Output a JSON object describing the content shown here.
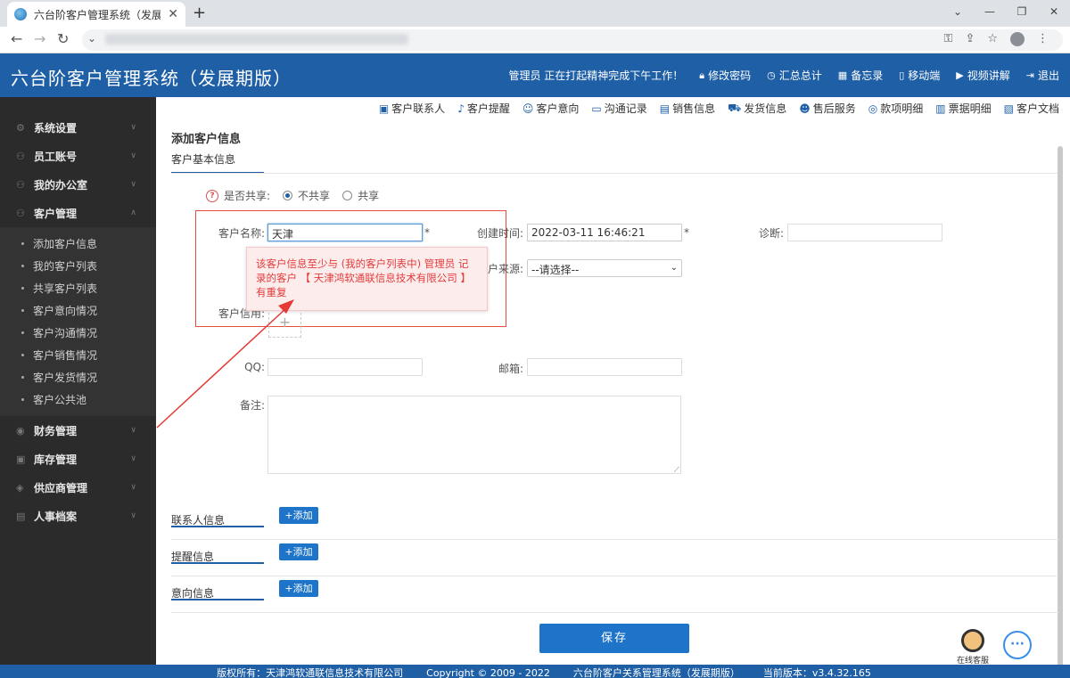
{
  "browser": {
    "tab_title": "六台阶客户管理系统（发展期版）",
    "close_tab": "✕",
    "new_tab": "+",
    "win_min": "⌄",
    "win_minimize": "—",
    "win_restore": "❐",
    "win_close": "✕"
  },
  "header": {
    "title": "六台阶客户管理系统（发展期版）",
    "welcome": "管理员 正在打起精神完成下午工作！",
    "links": [
      "修改密码",
      "汇总总计",
      "备忘录",
      "移动端",
      "视频讲解",
      "退出"
    ]
  },
  "sidebar": {
    "groups": [
      "系统设置",
      "员工账号",
      "我的办公室",
      "客户管理"
    ],
    "customer_items": [
      "添加客户信息",
      "我的客户列表",
      "共享客户列表",
      "客户意向情况",
      "客户沟通情况",
      "客户销售情况",
      "客户发货情况",
      "客户公共池"
    ],
    "groups_after": [
      "财务管理",
      "库存管理",
      "供应商管理",
      "人事档案"
    ]
  },
  "toolbar": {
    "items": [
      "客户联系人",
      "客户提醒",
      "客户意向",
      "沟通记录",
      "销售信息",
      "发货信息",
      "售后服务",
      "款项明细",
      "票据明细",
      "客户文档"
    ]
  },
  "form": {
    "page_title": "添加客户信息",
    "section_basic": "客户基本信息",
    "share_label": "是否共享:",
    "share_opt_no": "不共享",
    "share_opt_yes": "共享",
    "name_label": "客户名称:",
    "name_value": "天津",
    "required_mark": "*",
    "created_label": "创建时间:",
    "created_value": "2022-03-11 16:46:21",
    "diagnosis_label": "诊断:",
    "source_label": "户来源:",
    "source_value": "--请选择--",
    "credit_label": "客户信用:",
    "upload_plus": "+",
    "qq_label": "QQ:",
    "email_label": "邮箱:",
    "remark_label": "备注:",
    "tooltip": "该客户信息至少与 (我的客户列表中) 管理员 记录的客户 【 天津鸿软通联信息技术有限公司 】 有重复",
    "sections": [
      {
        "title": "联系人信息",
        "add": "+添加"
      },
      {
        "title": "提醒信息",
        "add": "+添加"
      },
      {
        "title": "意向信息",
        "add": "+添加"
      }
    ],
    "save": "保存"
  },
  "support": {
    "kefu": "在线客服",
    "chat_glyph": "···"
  },
  "footer": {
    "copyright_owner": "版权所有：天津鸿软通联信息技术有限公司",
    "copyright": "Copyright © 2009 - 2022",
    "product": "六台阶客户关系管理系统（发展期版）",
    "version": "当前版本：v3.4.32.165"
  },
  "colors": {
    "brand_blue": "#1e5fa6",
    "button_blue": "#1e74c9",
    "error_red": "#e74c3c",
    "sidebar_bg": "#2b2b2b"
  }
}
